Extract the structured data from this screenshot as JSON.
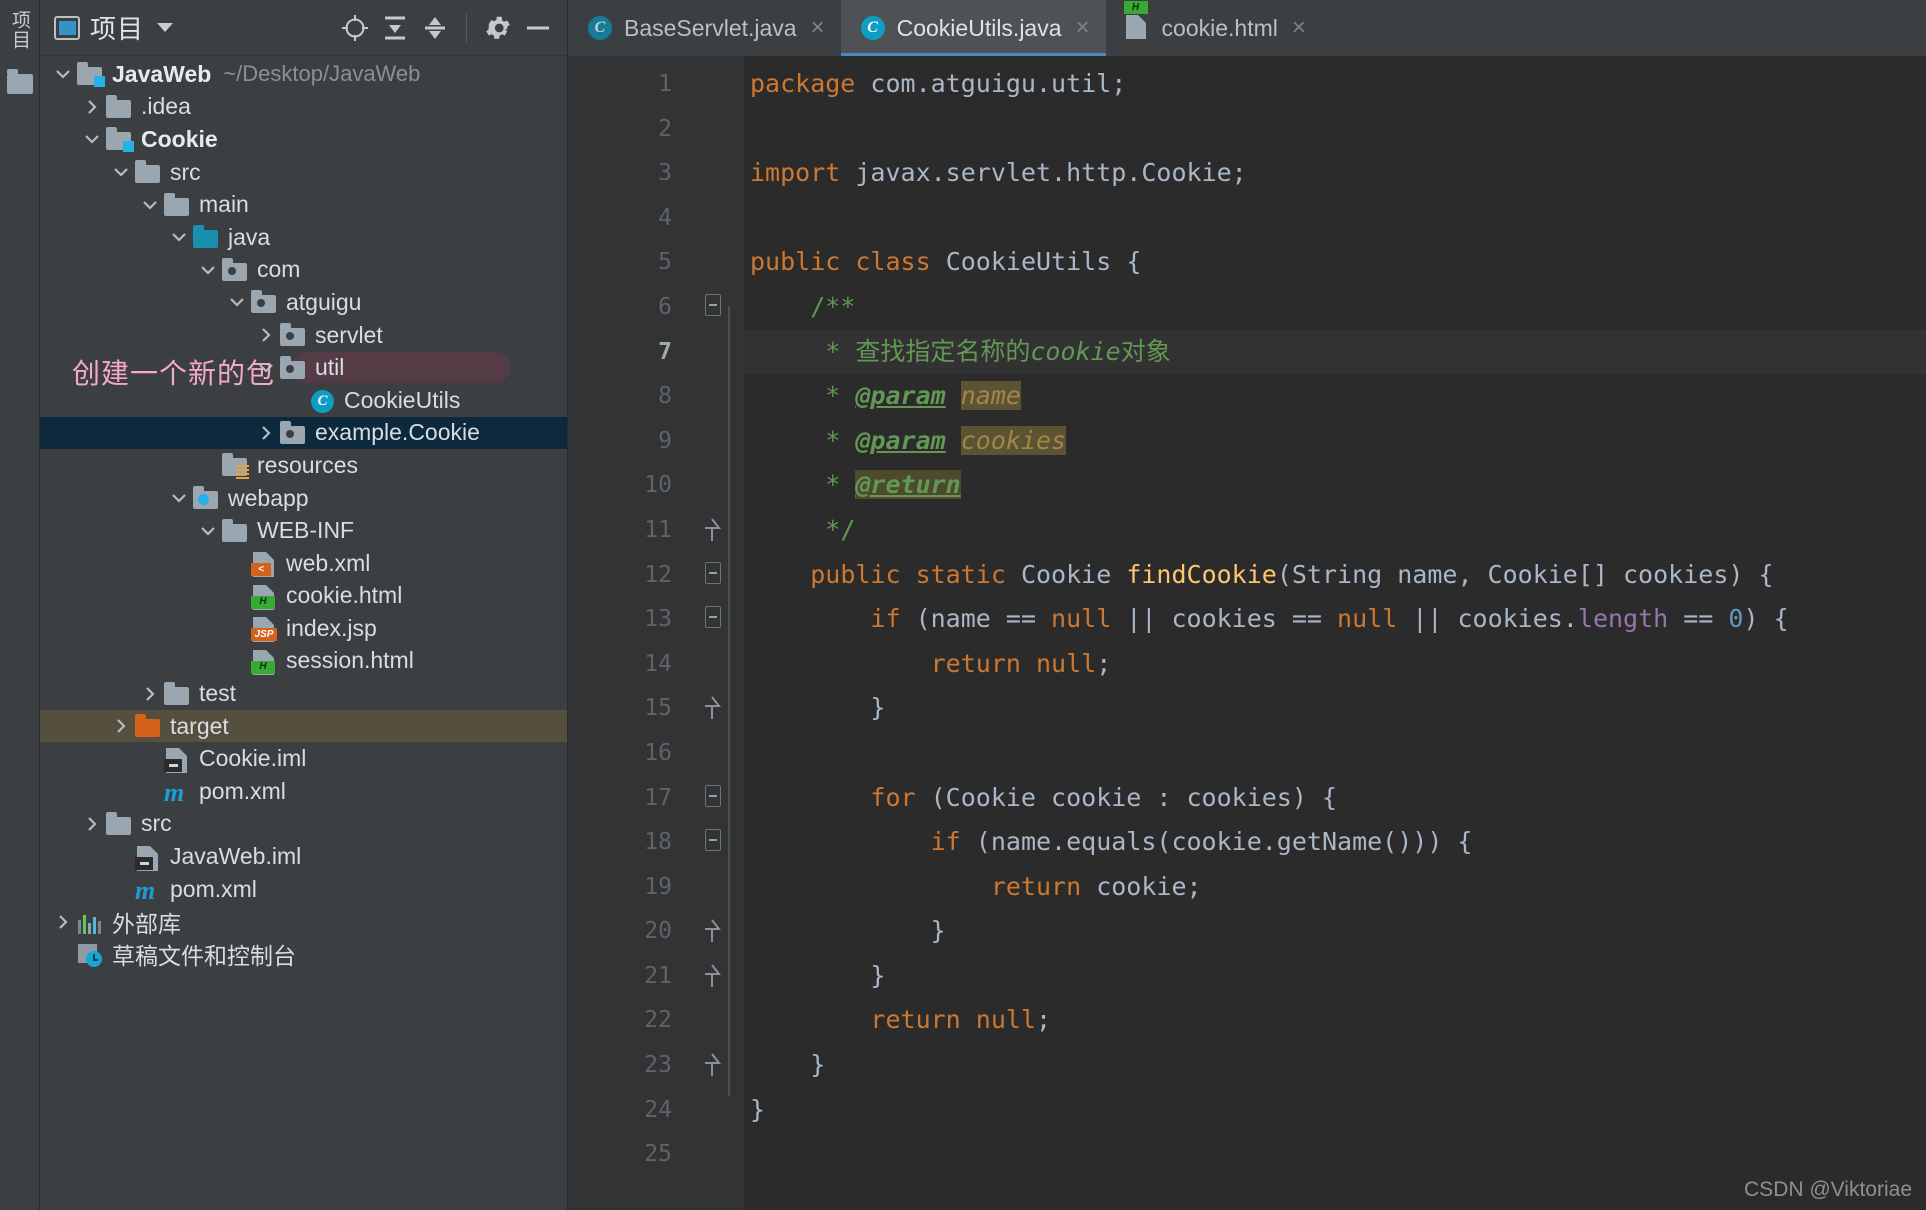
{
  "window": {
    "left_tool_strip": [
      "项目",
      "folder-icon"
    ]
  },
  "panel": {
    "title": "项目",
    "icons": [
      "project-icon",
      "chevron-down-icon",
      "locate-icon",
      "expand-all-icon",
      "collapse-all-icon",
      "settings-gear-icon",
      "minimize-icon"
    ]
  },
  "tree": {
    "items": [
      {
        "label": "JavaWeb",
        "suffix": "~/Desktop/JavaWeb",
        "indent": 0,
        "arrow": "down",
        "icon": "module-folder-icon",
        "bold": true,
        "state": "normal"
      },
      {
        "label": ".idea",
        "indent": 1,
        "arrow": "right",
        "icon": "folder-icon",
        "state": "normal"
      },
      {
        "label": "Cookie",
        "indent": 1,
        "arrow": "down",
        "icon": "module-folder-icon",
        "bold": true,
        "state": "normal"
      },
      {
        "label": "src",
        "indent": 2,
        "arrow": "down",
        "icon": "folder-icon",
        "state": "normal"
      },
      {
        "label": "main",
        "indent": 3,
        "arrow": "down",
        "icon": "folder-icon",
        "state": "normal"
      },
      {
        "label": "java",
        "indent": 4,
        "arrow": "down",
        "icon": "source-root-folder-icon",
        "state": "normal"
      },
      {
        "label": "com",
        "indent": 5,
        "arrow": "down",
        "icon": "package-folder-icon",
        "state": "normal"
      },
      {
        "label": "atguigu",
        "indent": 6,
        "arrow": "down",
        "icon": "package-folder-icon",
        "state": "normal"
      },
      {
        "label": "servlet",
        "indent": 7,
        "arrow": "right",
        "icon": "package-folder-icon",
        "state": "normal"
      },
      {
        "label": "util",
        "indent": 7,
        "arrow": "down",
        "icon": "package-folder-icon",
        "state": "annotated"
      },
      {
        "label": "CookieUtils",
        "indent": 8,
        "arrow": "none",
        "icon": "java-class-icon",
        "state": "normal"
      },
      {
        "label": "example.Cookie",
        "indent": 7,
        "arrow": "right",
        "icon": "package-folder-icon",
        "state": "selected"
      },
      {
        "label": "resources",
        "indent": 5,
        "arrow": "none",
        "icon": "resource-root-folder-icon",
        "state": "normal"
      },
      {
        "label": "webapp",
        "indent": 4,
        "arrow": "down",
        "icon": "web-root-folder-icon",
        "state": "normal"
      },
      {
        "label": "WEB-INF",
        "indent": 5,
        "arrow": "down",
        "icon": "folder-icon",
        "state": "normal"
      },
      {
        "label": "web.xml",
        "indent": 6,
        "arrow": "none",
        "icon": "xml-file-icon",
        "state": "normal"
      },
      {
        "label": "cookie.html",
        "indent": 6,
        "arrow": "none",
        "icon": "html-file-icon",
        "state": "normal"
      },
      {
        "label": "index.jsp",
        "indent": 6,
        "arrow": "none",
        "icon": "jsp-file-icon",
        "state": "normal"
      },
      {
        "label": "session.html",
        "indent": 6,
        "arrow": "none",
        "icon": "html-file-icon",
        "state": "normal"
      },
      {
        "label": "test",
        "indent": 3,
        "arrow": "right",
        "icon": "folder-icon",
        "state": "normal"
      },
      {
        "label": "target",
        "indent": 2,
        "arrow": "right",
        "icon": "excluded-folder-icon",
        "state": "excluded"
      },
      {
        "label": "Cookie.iml",
        "indent": 3,
        "arrow": "none",
        "icon": "iml-file-icon",
        "state": "normal"
      },
      {
        "label": "pom.xml",
        "indent": 3,
        "arrow": "none",
        "icon": "maven-file-icon",
        "state": "normal"
      },
      {
        "label": "src",
        "indent": 1,
        "arrow": "right",
        "icon": "folder-icon",
        "state": "normal"
      },
      {
        "label": "JavaWeb.iml",
        "indent": 2,
        "arrow": "none",
        "icon": "iml-file-icon",
        "state": "normal"
      },
      {
        "label": "pom.xml",
        "indent": 2,
        "arrow": "none",
        "icon": "maven-file-icon",
        "state": "normal"
      },
      {
        "label": "外部库",
        "indent": 0,
        "arrow": "right",
        "icon": "external-libraries-icon",
        "state": "normal"
      },
      {
        "label": "草稿文件和控制台",
        "indent": 0,
        "arrow": "none",
        "icon": "scratches-and-consoles-icon",
        "state": "normal"
      }
    ]
  },
  "annotation": {
    "text": "创建一个新的包",
    "color": "#f5a8c8"
  },
  "tabs": [
    {
      "label": "BaseServlet.java",
      "icon": "java-class-icon",
      "active": false,
      "close": "×"
    },
    {
      "label": "CookieUtils.java",
      "icon": "java-class-icon",
      "active": true,
      "close": "×"
    },
    {
      "label": "cookie.html",
      "icon": "html-file-icon",
      "active": false,
      "close": "×"
    }
  ],
  "editor": {
    "current_line": 7,
    "line_numbers": [
      "1",
      "2",
      "3",
      "4",
      "5",
      "6",
      "7",
      "8",
      "9",
      "10",
      "11",
      "12",
      "13",
      "14",
      "15",
      "16",
      "17",
      "18",
      "19",
      "20",
      "21",
      "22",
      "23",
      "24",
      "25"
    ],
    "lines": [
      {
        "n": 1,
        "text": "package com.atguigu.util;"
      },
      {
        "n": 2,
        "text": ""
      },
      {
        "n": 3,
        "text": "import javax.servlet.http.Cookie;"
      },
      {
        "n": 4,
        "text": ""
      },
      {
        "n": 5,
        "text": "public class CookieUtils {"
      },
      {
        "n": 6,
        "text": "    /**"
      },
      {
        "n": 7,
        "text": "     * 查找指定名称的cookie对象"
      },
      {
        "n": 8,
        "text": "     * @param name"
      },
      {
        "n": 9,
        "text": "     * @param cookies"
      },
      {
        "n": 10,
        "text": "     * @return"
      },
      {
        "n": 11,
        "text": "     */"
      },
      {
        "n": 12,
        "text": "    public static Cookie findCookie(String name, Cookie[] cookies) {"
      },
      {
        "n": 13,
        "text": "        if (name == null || cookies == null || cookies.length == 0) {"
      },
      {
        "n": 14,
        "text": "            return null;"
      },
      {
        "n": 15,
        "text": "        }"
      },
      {
        "n": 16,
        "text": ""
      },
      {
        "n": 17,
        "text": "        for (Cookie cookie : cookies) {"
      },
      {
        "n": 18,
        "text": "            if (name.equals(cookie.getName())) {"
      },
      {
        "n": 19,
        "text": "                return cookie;"
      },
      {
        "n": 20,
        "text": "            }"
      },
      {
        "n": 21,
        "text": "        }"
      },
      {
        "n": 22,
        "text": "        return null;"
      },
      {
        "n": 23,
        "text": "    }"
      },
      {
        "n": 24,
        "text": "}"
      },
      {
        "n": 25,
        "text": ""
      }
    ],
    "gutter_markers": {
      "fold_minus_lines": [
        6,
        12,
        13
      ],
      "fold_up_lines": [
        11,
        15,
        20,
        21,
        23
      ],
      "fold_minus2_lines": [
        17,
        18
      ],
      "bulb_line": 7
    }
  },
  "watermark": "CSDN @Viktoriae",
  "colors": {
    "panel_bg": "#3c3f41",
    "editor_bg": "#2b2b2b",
    "gutter_bg": "#313335",
    "selection": "#0d293e",
    "excluded": "#544f3f",
    "tab_active": "#4e5254",
    "accent": "#3592c4",
    "annotation_pink": "#f5a8c8",
    "comment_green": "#629755",
    "keyword_orange": "#cc7832",
    "method_yellow": "#ffc66d",
    "number_blue": "#6897bb"
  }
}
